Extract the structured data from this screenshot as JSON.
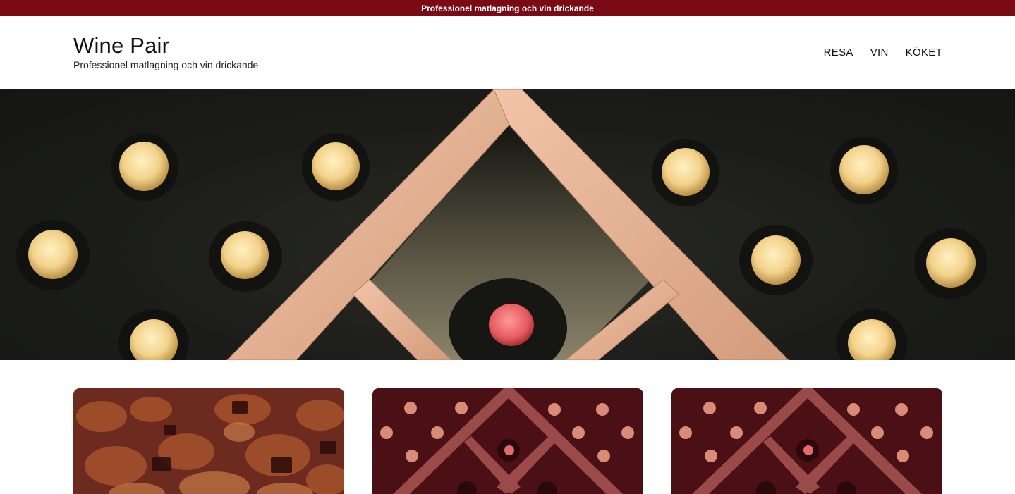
{
  "announcement": "Professionel matlagning och vin drickande",
  "site": {
    "title": "Wine Pair",
    "tagline": "Professionel matlagning och vin drickande"
  },
  "nav": {
    "items": [
      {
        "label": "RESA"
      },
      {
        "label": "VIN"
      },
      {
        "label": "KÖKET"
      }
    ]
  },
  "colors": {
    "brand": "#7a0a14",
    "card_overlay": "#5a1018"
  }
}
